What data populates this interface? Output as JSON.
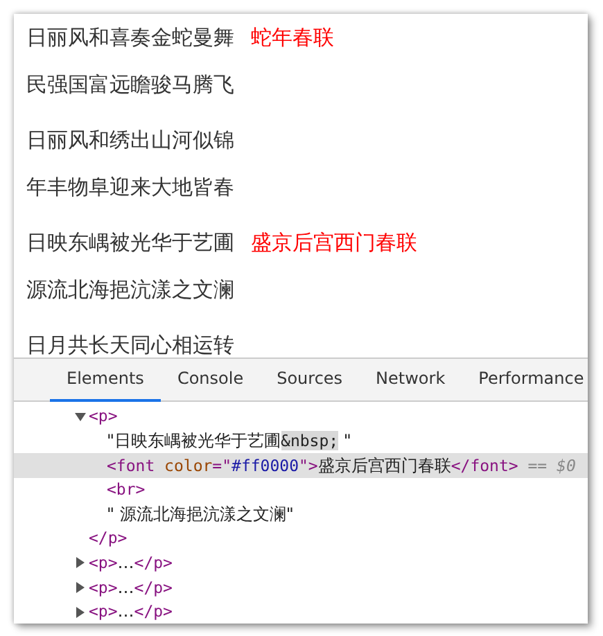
{
  "page": {
    "paragraphs": [
      {
        "lines": [
          "日丽风和喜奏金蛇曼舞",
          "民强国富远瞻骏马腾飞"
        ],
        "note": "蛇年春联",
        "color": "#ff0000"
      },
      {
        "lines": [
          "日丽风和绣出山河似锦",
          "年丰物阜迎来大地皆春"
        ]
      },
      {
        "lines": [
          "日映东嵎被光华于艺圃",
          "源流北海挹沆漾之文澜"
        ],
        "note": "盛京后宫西门春联",
        "color": "#ff0000"
      },
      {
        "lines": [
          "日月共长天同心相运转"
        ]
      }
    ]
  },
  "devtools": {
    "tabs": [
      {
        "label": "Elements",
        "selected": true
      },
      {
        "label": "Console",
        "selected": false
      },
      {
        "label": "Sources",
        "selected": false
      },
      {
        "label": "Network",
        "selected": false
      },
      {
        "label": "Performance",
        "selected": false
      }
    ],
    "dom_tree": [
      {
        "expanded": true,
        "selected": false,
        "tokens": [
          {
            "kind": "tag",
            "text": "<p>"
          }
        ],
        "children": [
          {
            "selected": false,
            "tokens": [
              {
                "kind": "text",
                "text": "\"日映东嵎被光华于艺圃"
              },
              {
                "kind": "entity",
                "text": "&nbsp;"
              },
              {
                "kind": "text",
                "text": " \""
              }
            ]
          },
          {
            "selected": true,
            "tokens": [
              {
                "kind": "tag",
                "text": "<font "
              },
              {
                "kind": "attr",
                "text": "color"
              },
              {
                "kind": "tag",
                "text": "=\""
              },
              {
                "kind": "value",
                "text": "#ff0000"
              },
              {
                "kind": "tag",
                "text": "\">"
              },
              {
                "kind": "text",
                "text": "盛京后宫西门春联"
              },
              {
                "kind": "tag",
                "text": "</font>"
              },
              {
                "kind": "ref",
                "text": " == $0"
              }
            ]
          },
          {
            "selected": false,
            "tokens": [
              {
                "kind": "tag",
                "text": "<br>"
              }
            ]
          },
          {
            "selected": false,
            "tokens": [
              {
                "kind": "text",
                "text": "\" 源流北海挹沆漾之文澜\""
              }
            ]
          }
        ],
        "closing": [
          {
            "kind": "tag",
            "text": "</p>"
          }
        ]
      },
      {
        "expanded": false,
        "selected": false,
        "tokens": [
          {
            "kind": "tag",
            "text": "<p>"
          },
          {
            "kind": "text",
            "text": "…"
          },
          {
            "kind": "tag",
            "text": "</p>"
          }
        ]
      },
      {
        "expanded": false,
        "selected": false,
        "tokens": [
          {
            "kind": "tag",
            "text": "<p>"
          },
          {
            "kind": "text",
            "text": "…"
          },
          {
            "kind": "tag",
            "text": "</p>"
          }
        ]
      },
      {
        "expanded": false,
        "selected": false,
        "tokens": [
          {
            "kind": "tag",
            "text": "<p>"
          },
          {
            "kind": "text",
            "text": "…"
          },
          {
            "kind": "tag",
            "text": "</p>"
          }
        ]
      }
    ]
  }
}
